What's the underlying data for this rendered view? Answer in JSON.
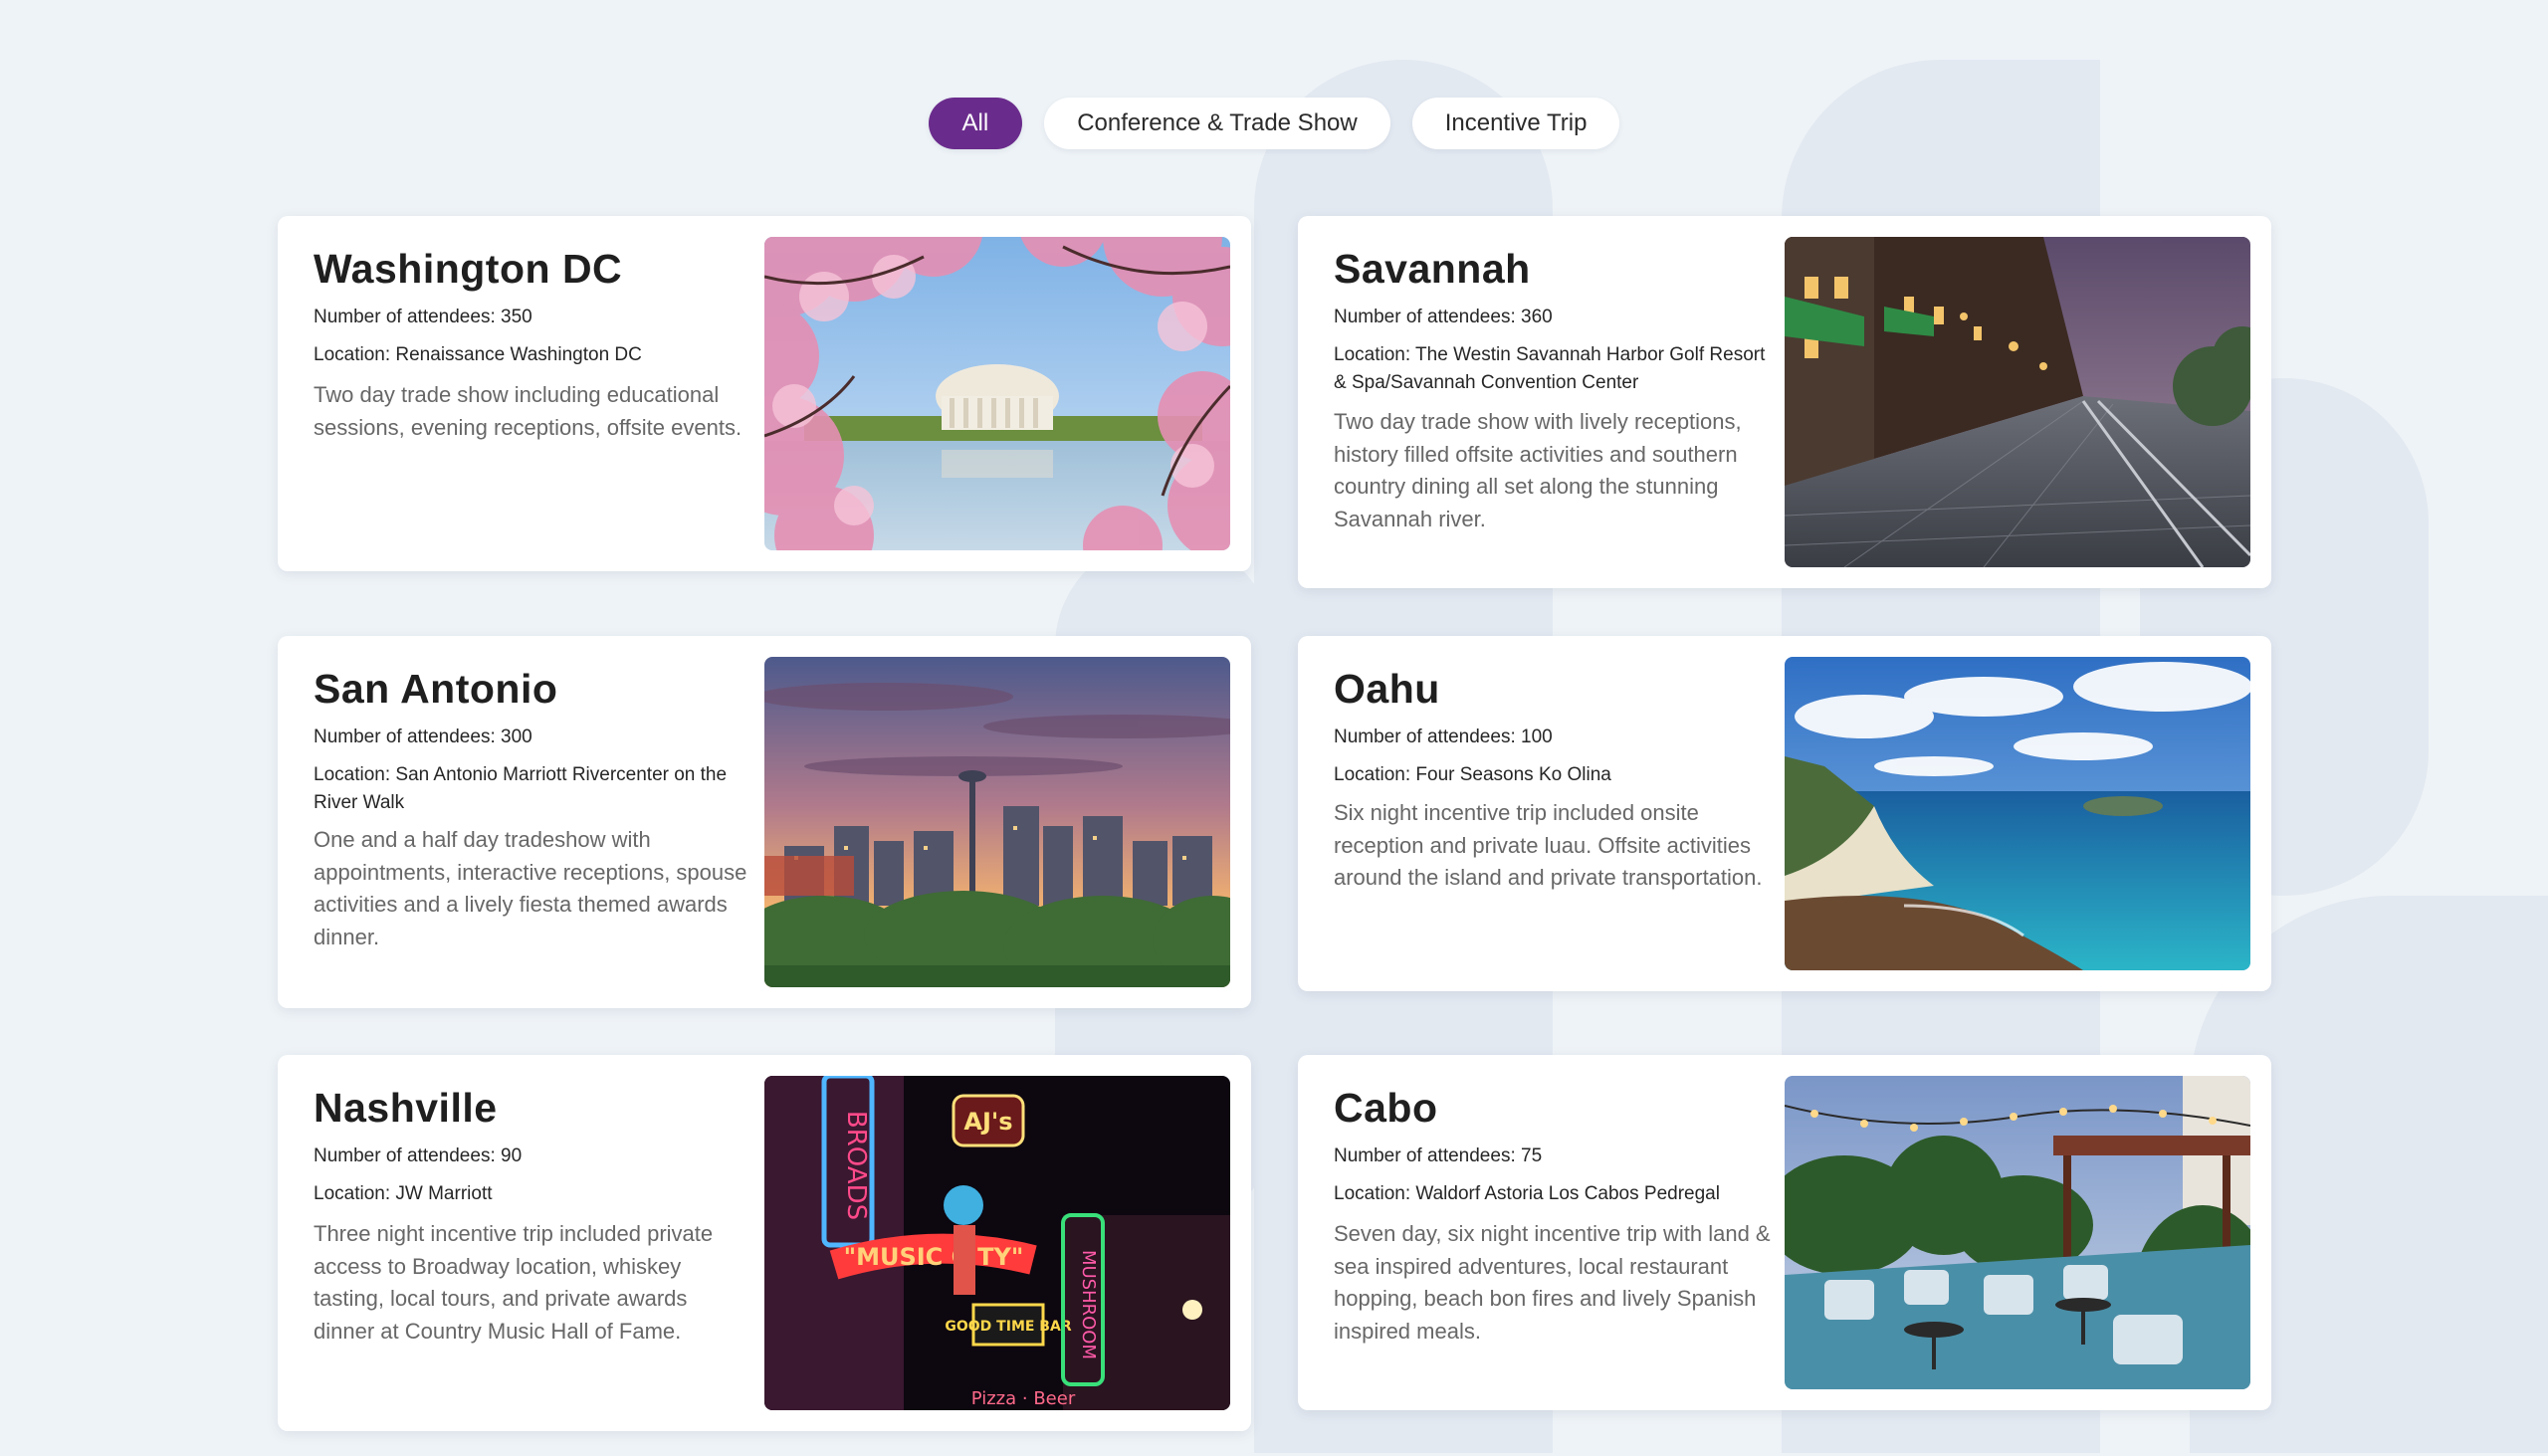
{
  "filters": [
    {
      "label": "All",
      "active": true
    },
    {
      "label": "Conference & Trade Show",
      "active": false
    },
    {
      "label": "Incentive Trip",
      "active": false
    }
  ],
  "cards": [
    {
      "title": "Washington DC",
      "attendees": "Number of attendees: 350",
      "location": "Location: Renaissance Washington DC",
      "description": "Two day trade show including educational sessions, evening receptions, offsite events.",
      "image_icon": "cherry-blossom-memorial-photo"
    },
    {
      "title": "Savannah",
      "attendees": "Number of attendees: 360",
      "location": "Location: The Westin Savannah Harbor Golf Resort & Spa/Savannah Convention Center",
      "description": "Two day trade show with lively receptions, history filled offsite activities and southern country dining all set along the stunning Savannah river.",
      "image_icon": "cobblestone-street-night-photo"
    },
    {
      "title": "San Antonio",
      "attendees": "Number of attendees: 300",
      "location": "Location: San Antonio Marriott Rivercenter on the River Walk",
      "description": "One and a half day tradeshow with appointments, interactive receptions, spouse activities and a lively fiesta themed awards dinner.",
      "image_icon": "city-skyline-sunset-photo"
    },
    {
      "title": "Oahu",
      "attendees": "Number of attendees: 100",
      "location": "Location: Four Seasons Ko Olina",
      "description": "Six night incentive trip included onsite reception and private luau. Offsite activities around the island and private transportation.",
      "image_icon": "tropical-coastline-photo"
    },
    {
      "title": "Nashville",
      "attendees": "Number of attendees: 90",
      "location": "Location: JW Marriott",
      "description": "Three night incentive trip included private access to Broadway location, whiskey tasting, local tours, and private awards dinner at Country Music Hall of Fame.",
      "image_icon": "neon-signs-broadway-photo",
      "image_text": {
        "sign1": "BROADS",
        "sign2": "AJ's",
        "sign3": "\"MUSIC CITY\"",
        "sign4": "GOOD TIME BAR",
        "sign5": "MUSHROOM",
        "sign6": "Pizza · Beer"
      }
    },
    {
      "title": "Cabo",
      "attendees": "Number of attendees: 75",
      "location": "Location: Waldorf Astoria Los Cabos Pedregal",
      "description": "Seven day, six night incentive trip with land & sea inspired adventures, local restaurant hopping, beach bon fires and lively Spanish inspired meals.",
      "image_icon": "outdoor-patio-restaurant-photo"
    }
  ]
}
